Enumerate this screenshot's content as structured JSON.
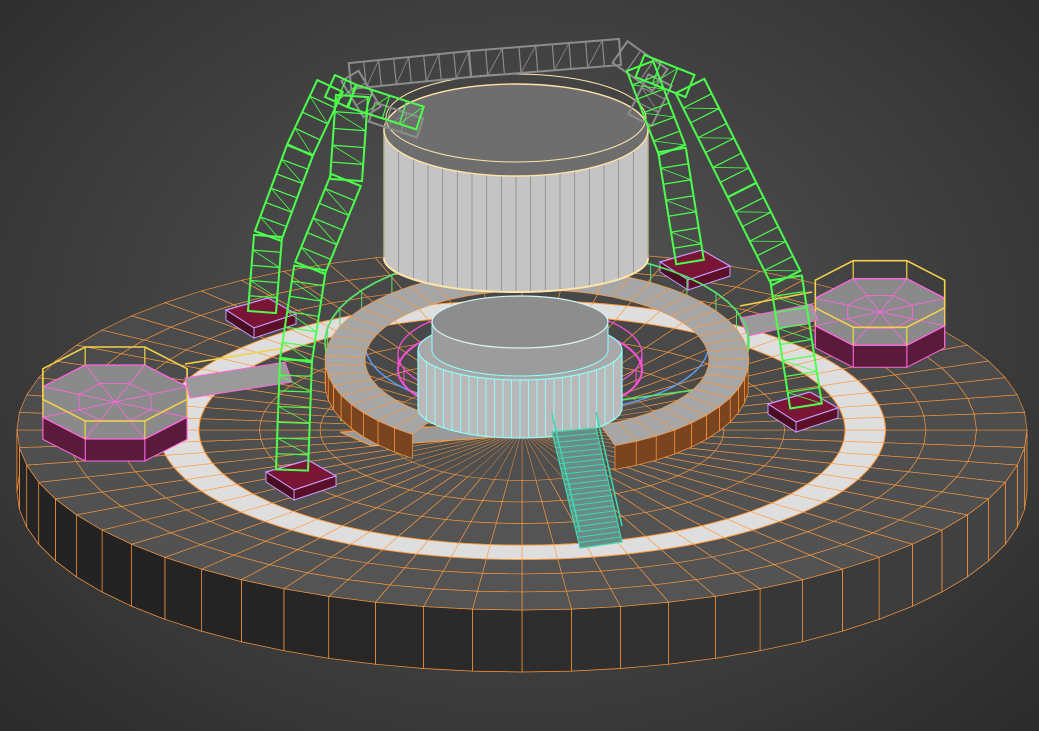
{
  "viewport": {
    "kind": "3d-modeling-viewport",
    "shading": "shaded-with-edged-faces"
  },
  "scene": {
    "objects": [
      {
        "name": "circular-base-platform",
        "wire_color": "#ff9a3c"
      },
      {
        "name": "white-ring-band",
        "wire_color": "#ff9a3c"
      },
      {
        "name": "green-truss-arches",
        "wire_color": "#4cff4c"
      },
      {
        "name": "grey-truss-frame",
        "wire_color": "#8c8c8c"
      },
      {
        "name": "suspended-cylinder",
        "wire_color": "#ffe4a8"
      },
      {
        "name": "central-cylinder-base",
        "wire_color": "#8fffff"
      },
      {
        "name": "pink-inner-ring",
        "wire_color": "#ff4fd8"
      },
      {
        "name": "c-shaped-walkway",
        "wire_color": "#ff9a3c"
      },
      {
        "name": "walkway-railings",
        "wire_color": "#58e06a"
      },
      {
        "name": "teal-stairs",
        "wire_color": "#3fd7b0"
      },
      {
        "name": "octagon-platform-left",
        "wire_color": "#ff66e0"
      },
      {
        "name": "octagon-platform-right",
        "wire_color": "#ff66e0"
      },
      {
        "name": "truss-base-pads",
        "wire_color": "#c69cff"
      }
    ]
  }
}
